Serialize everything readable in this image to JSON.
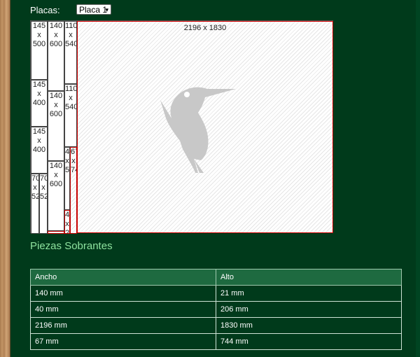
{
  "header": {
    "placas_label": "Placas:",
    "placa_selected": "Placa 1",
    "caret_icon": "▾"
  },
  "board": {
    "remnant_label": "2196 x 1830",
    "pieces": {
      "c1_p1": [
        "145",
        "x",
        "500"
      ],
      "c1_p2": [
        "145",
        "x",
        "400"
      ],
      "c1_p3": [
        "145",
        "x",
        "400"
      ],
      "c1_p4a": [
        "70",
        "x",
        "52"
      ],
      "c1_p4b": [
        "70",
        "x",
        "52"
      ],
      "c2_p1": [
        "140",
        "x",
        "600"
      ],
      "c2_p2": [
        "140",
        "x",
        "600"
      ],
      "c2_p3": [
        "140",
        "x",
        "600"
      ],
      "c3_p1": [
        "110",
        "x",
        "540"
      ],
      "c3_p2": [
        "110",
        "x",
        "540"
      ],
      "c3_p3a": [
        "4",
        "x",
        "5"
      ],
      "c3_p3b": [
        "67",
        "x",
        "74"
      ],
      "c3_p4": [
        "4",
        "x",
        "2"
      ]
    }
  },
  "section_title": "Piezas Sobrantes",
  "table": {
    "headers": [
      "Ancho",
      "Alto"
    ],
    "rows": [
      [
        "140 mm",
        "21 mm"
      ],
      [
        "40 mm",
        "206 mm"
      ],
      [
        "2196 mm",
        "1830 mm"
      ],
      [
        "67 mm",
        "744 mm"
      ]
    ]
  }
}
